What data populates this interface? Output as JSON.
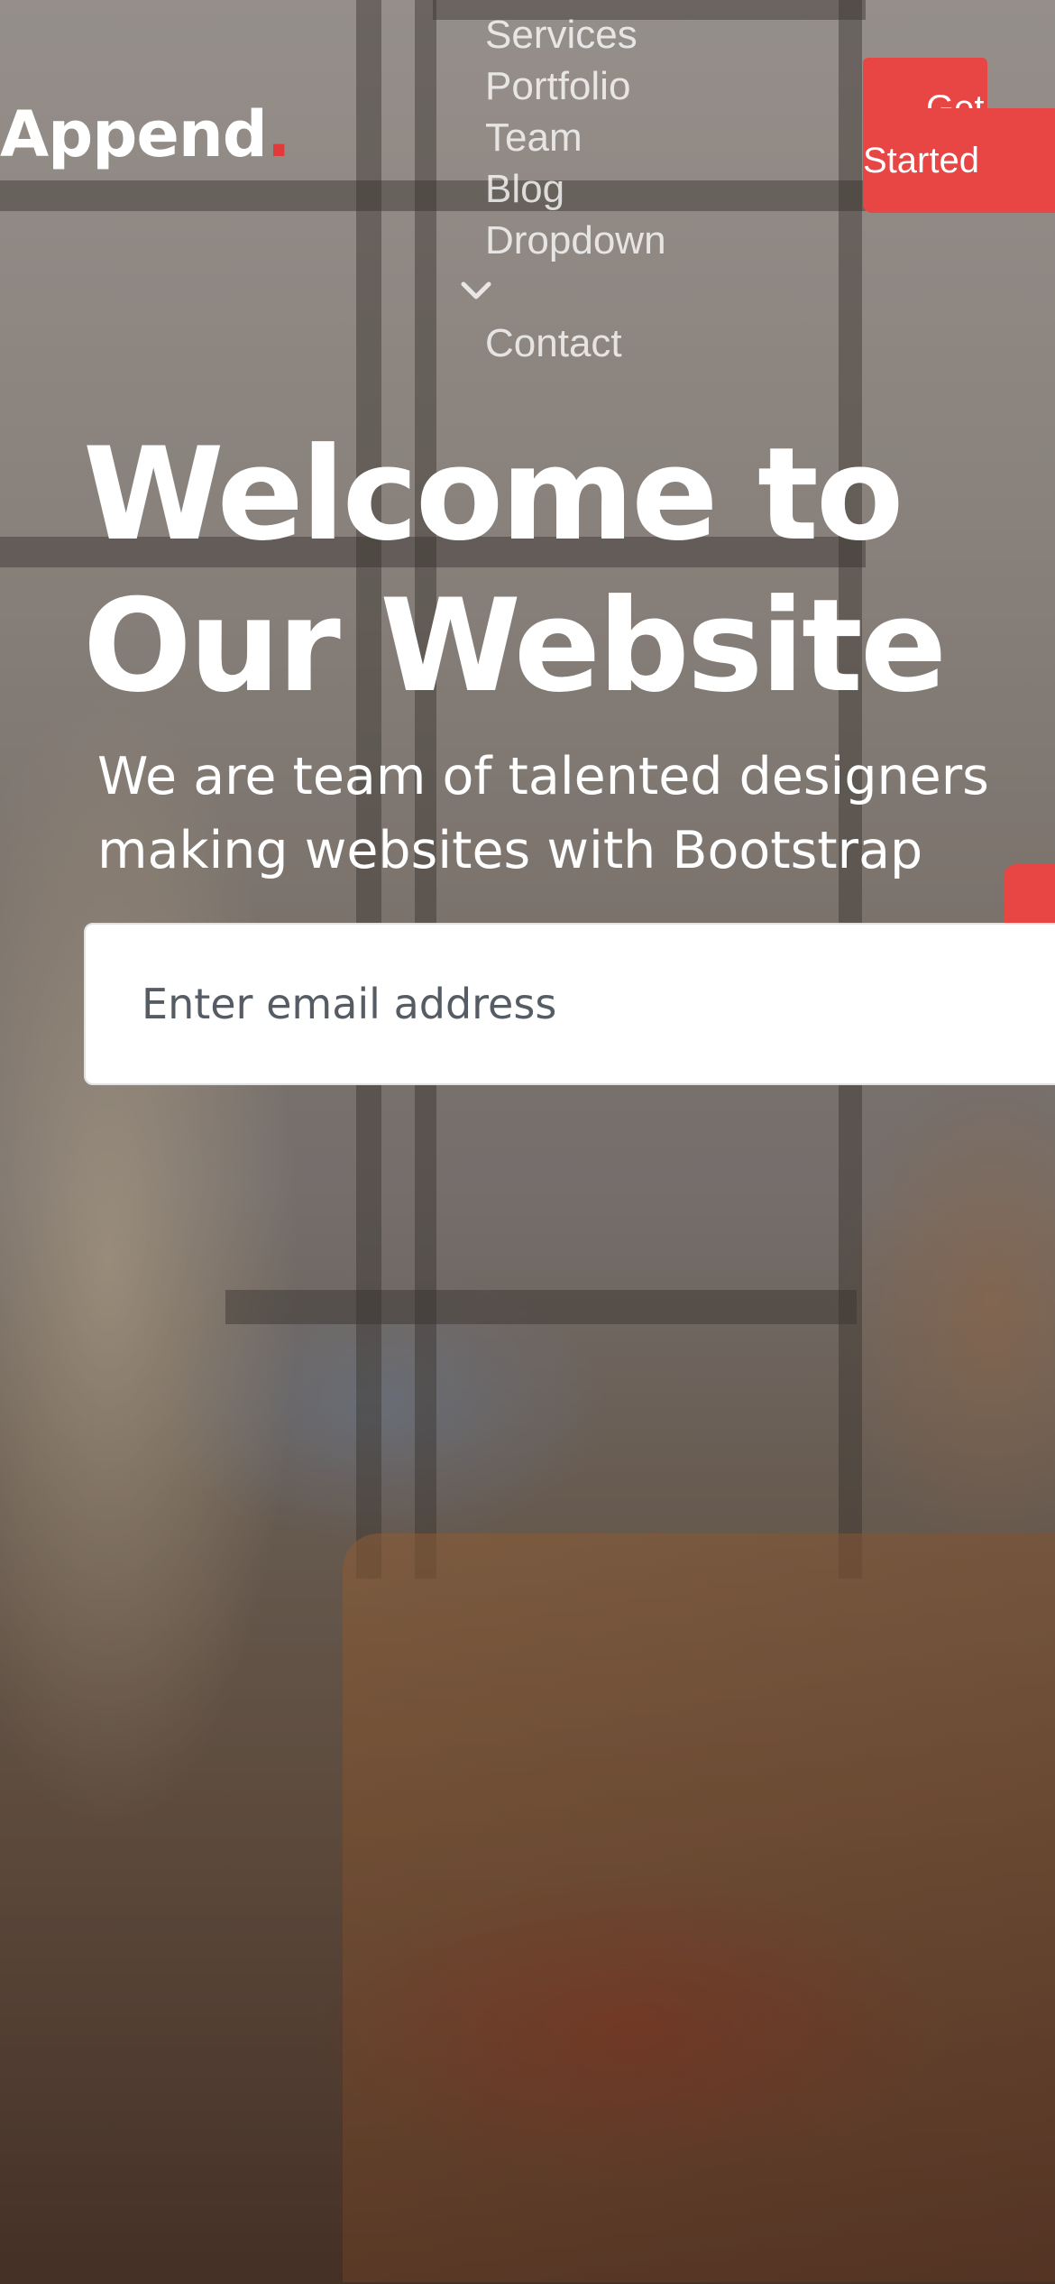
{
  "brand": {
    "name": "Append",
    "dot": ".",
    "accent_color": "#e84545"
  },
  "nav": {
    "items": [
      {
        "label": "Services"
      },
      {
        "label": "Portfolio"
      },
      {
        "label": "Team"
      },
      {
        "label": "Blog"
      },
      {
        "label": "Dropdown",
        "icon": "chevron-down-icon"
      },
      {
        "label": "Contact"
      }
    ],
    "cta_top": "Get",
    "cta_label": "Started"
  },
  "hero": {
    "title_line1": "Welcome to",
    "title_line2": "Our Website",
    "subtitle": "We are team of talented designers making websites with Bootstrap"
  },
  "form": {
    "email_placeholder": "Enter email address",
    "email_value": ""
  }
}
